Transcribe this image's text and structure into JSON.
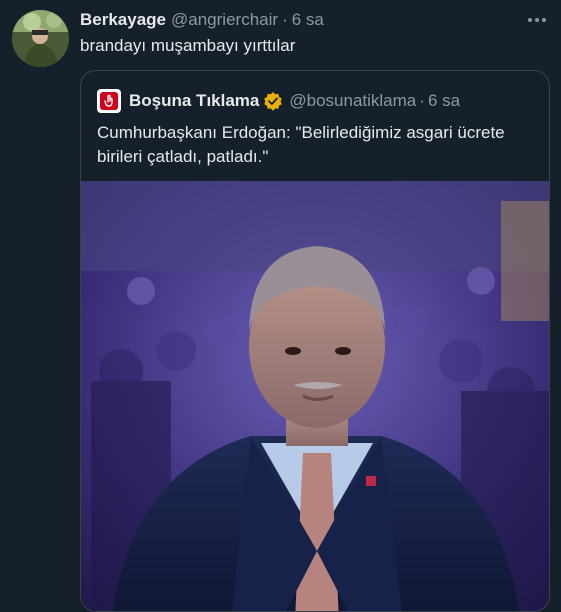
{
  "tweet": {
    "display_name": "Berkayage",
    "handle": "@angrierchair",
    "separator": "·",
    "time": "6 sa",
    "text": "brandayı muşambayı yırttılar",
    "more_icon": "more-horizontal-icon"
  },
  "quote": {
    "display_name": "Boşuna Tıklama",
    "handle": "@bosunatiklama",
    "separator": "·",
    "time": "6 sa",
    "verified_icon": "verified-badge-icon",
    "verified_color": "#e8b20b",
    "text": "Cumhurbaşkanı Erdoğan: \"Belirlediğimiz asgari ücrete birileri çatladı, patladı.\""
  },
  "colors": {
    "background": "#15202b",
    "border": "#38444d",
    "secondary_text": "#8b98a5",
    "primary_text": "#e7e9ea",
    "brand_red": "#d0021b"
  }
}
